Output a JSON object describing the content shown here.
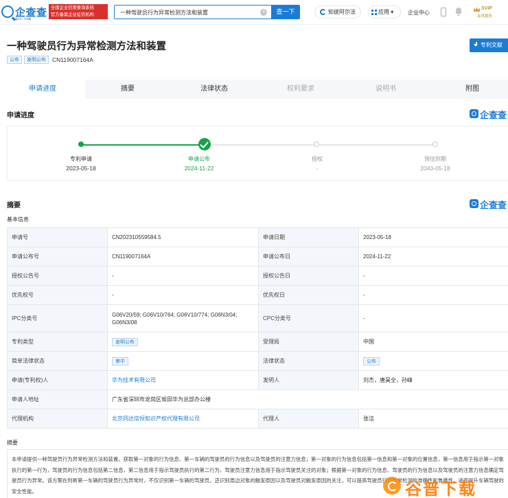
{
  "header": {
    "logo_text": "企查查",
    "logo_sub": "Qcc.com",
    "red_badge_line1": "全国企业信用查询系统",
    "red_badge_line2": "官方备案企业征信机构",
    "search_value": "一种驾驶员行为异常检测方法和装置",
    "search_button": "查一下",
    "law_link": "知彼阿尔法",
    "app_menu": "应用",
    "enterprise_center": "企业中心",
    "svip_label": "SVIP",
    "svip_sub": "会员服务"
  },
  "patent": {
    "title": "一种驾驶员行为异常检测方法和装置",
    "download_button": "专利文献",
    "tags": [
      "公布",
      "发明公布"
    ],
    "pub_no": "CN119007164A"
  },
  "tabs": [
    {
      "label": "申请进度",
      "state": "active"
    },
    {
      "label": "摘要",
      "state": "normal"
    },
    {
      "label": "法律状态",
      "state": "normal"
    },
    {
      "label": "权利要求",
      "state": "disabled"
    },
    {
      "label": "说明书",
      "state": "disabled"
    },
    {
      "label": "附图",
      "state": "normal"
    }
  ],
  "progress_section": {
    "title": "申请进度",
    "brand": "企查查",
    "steps": [
      {
        "label": "专利申请",
        "date": "2023-05-18",
        "state": "done"
      },
      {
        "label": "申请公布",
        "date": "2024-11-22",
        "state": "current"
      },
      {
        "label": "授权",
        "date": "-",
        "state": "pending"
      },
      {
        "label": "预估到期",
        "date": "2043-05-18",
        "state": "pending"
      }
    ]
  },
  "summary_section": {
    "title": "摘要",
    "brand": "企查查",
    "basic_info_label": "基本信息",
    "rows": [
      {
        "k1": "申请号",
        "v1": "CN202310559584.5",
        "k2": "申请日期",
        "v2": "2023-05-18"
      },
      {
        "k1": "申请公布号",
        "v1": "CN119007164A",
        "k2": "申请公布日",
        "v2": "2024-11-22"
      },
      {
        "k1": "授权公告号",
        "v1": "-",
        "k2": "授权公告日",
        "v2": "-"
      },
      {
        "k1": "优先权号",
        "v1": "-",
        "k2": "优先权日",
        "v2": "-"
      },
      {
        "k1": "IPC分类号",
        "v1": "G06V20/59; G06V10/764; G06V10/774; G06N3/04; G06N3/08",
        "k2": "CPC分类号",
        "v2": "-"
      },
      {
        "k1": "专利类型",
        "v1": "发明公布",
        "k2": "受理局",
        "v2": "中国"
      },
      {
        "k1": "简单法律状态",
        "v1": "审中",
        "k2": "法律状态",
        "v2": "公布"
      },
      {
        "k1": "申请(专利权)人",
        "v1": "华为技术有限公司",
        "k2": "发明人",
        "v2": "刘杰，唐昊全，孙峰"
      },
      {
        "k1": "申请人地址",
        "v1": "广东省深圳市龙岗区坂田华为总部办公楼"
      },
      {
        "k1": "代理机构",
        "v1": "北京同达信恒知识产权代理有限公司",
        "k2": "代理人",
        "v2": "张洁"
      }
    ],
    "abstract_label": "摘要",
    "abstract_text": "本申请提供一种驾驶员行为异常检测方法和装置。获取第一对象的行为信息、第一车辆的驾驶员的行为信息以及驾驶员的注意力信息；第一对象的行为信息包括第一信息和第一对象的位置信息，第一信息用于指示第一对象执行的第一行为，驾驶员的行为信息包括第二信息，第二信息用于指示驾驶员执行的第二行为，驾驶员注意力信息用于指示驾驶员关注的对象；根据第一对象的行为信息、驾驶员的行为信息以及驾驶员的注意力信息确定驾驶员行为异常。该方案在判断第一车辆的驾驶员行为异常时，不仅识别第一车辆的驾驶员，还识别周边对象的触发原因以及驾驶员对触发原因的关注，可以提高驾驶员行为异常检测的准确性和鲁棒性，进而提升车辆驾驶的安全性能。"
  },
  "watermark": "谷普下载",
  "colors": {
    "accent": "#1a7cd6",
    "success": "#16a34a",
    "badge_red": "#d9302c",
    "watermark": "#ff7a00"
  }
}
